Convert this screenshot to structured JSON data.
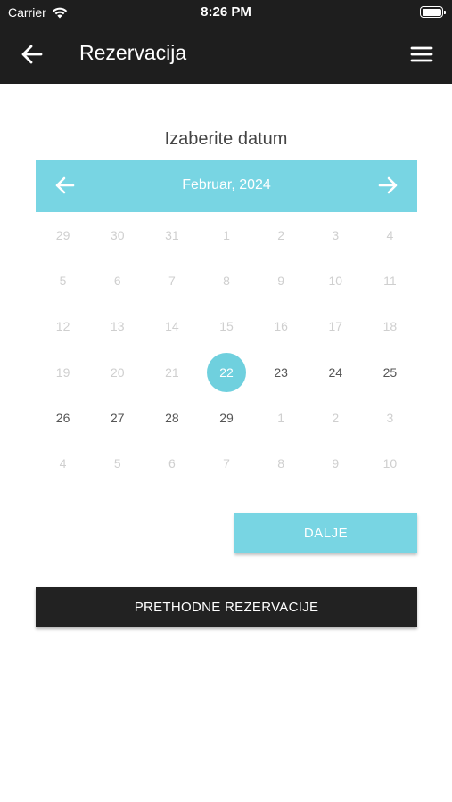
{
  "status_bar": {
    "carrier": "Carrier",
    "time": "8:26 PM",
    "battery_level": 1.0
  },
  "header": {
    "title": "Rezervacija",
    "back_icon": "arrow-left-icon",
    "menu_icon": "hamburger-menu-icon"
  },
  "section_title": "Izaberite datum",
  "calendar": {
    "month_label": "Februar, 2024",
    "prev_icon": "arrow-left-icon",
    "next_icon": "arrow-right-icon",
    "accent_color": "#78d5e3",
    "selected_day": "22",
    "weeks": [
      [
        {
          "d": "29",
          "s": "muted"
        },
        {
          "d": "30",
          "s": "muted"
        },
        {
          "d": "31",
          "s": "muted"
        },
        {
          "d": "1",
          "s": "muted"
        },
        {
          "d": "2",
          "s": "muted"
        },
        {
          "d": "3",
          "s": "muted"
        },
        {
          "d": "4",
          "s": "muted"
        }
      ],
      [
        {
          "d": "5",
          "s": "muted"
        },
        {
          "d": "6",
          "s": "muted"
        },
        {
          "d": "7",
          "s": "muted"
        },
        {
          "d": "8",
          "s": "muted"
        },
        {
          "d": "9",
          "s": "muted"
        },
        {
          "d": "10",
          "s": "muted"
        },
        {
          "d": "11",
          "s": "muted"
        }
      ],
      [
        {
          "d": "12",
          "s": "muted"
        },
        {
          "d": "13",
          "s": "muted"
        },
        {
          "d": "14",
          "s": "muted"
        },
        {
          "d": "15",
          "s": "muted"
        },
        {
          "d": "16",
          "s": "muted"
        },
        {
          "d": "17",
          "s": "muted"
        },
        {
          "d": "18",
          "s": "muted"
        }
      ],
      [
        {
          "d": "19",
          "s": "muted"
        },
        {
          "d": "20",
          "s": "muted"
        },
        {
          "d": "21",
          "s": "muted"
        },
        {
          "d": "22",
          "s": "selected"
        },
        {
          "d": "23",
          "s": "active"
        },
        {
          "d": "24",
          "s": "active"
        },
        {
          "d": "25",
          "s": "active"
        }
      ],
      [
        {
          "d": "26",
          "s": "active"
        },
        {
          "d": "27",
          "s": "active"
        },
        {
          "d": "28",
          "s": "active"
        },
        {
          "d": "29",
          "s": "active"
        },
        {
          "d": "1",
          "s": "muted"
        },
        {
          "d": "2",
          "s": "muted"
        },
        {
          "d": "3",
          "s": "muted"
        }
      ],
      [
        {
          "d": "4",
          "s": "muted"
        },
        {
          "d": "5",
          "s": "muted"
        },
        {
          "d": "6",
          "s": "muted"
        },
        {
          "d": "7",
          "s": "muted"
        },
        {
          "d": "8",
          "s": "muted"
        },
        {
          "d": "9",
          "s": "muted"
        },
        {
          "d": "10",
          "s": "muted"
        }
      ]
    ]
  },
  "buttons": {
    "next_label": "DALJE",
    "previous_reservations_label": "PRETHODNE REZERVACIJE"
  }
}
